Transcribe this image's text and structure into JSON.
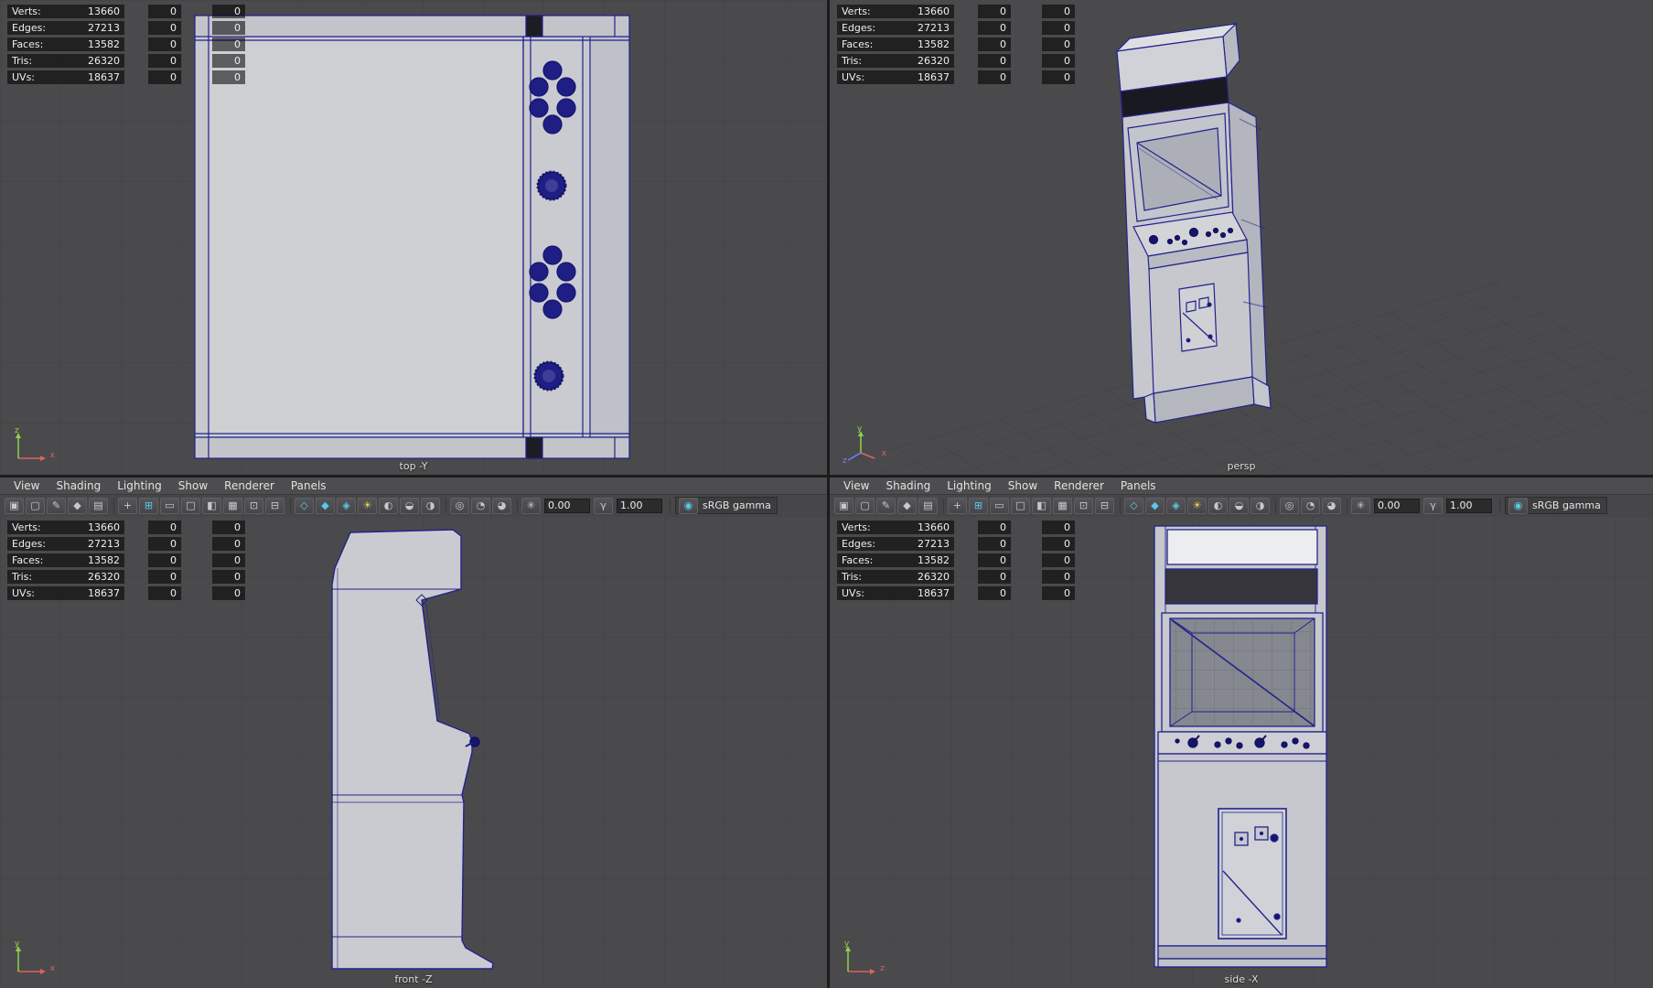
{
  "hud": {
    "rows": [
      {
        "label": "Verts:",
        "total": "13660",
        "c2": "0",
        "c3": "0"
      },
      {
        "label": "Edges:",
        "total": "27213",
        "c2": "0",
        "c3": "0"
      },
      {
        "label": "Faces:",
        "total": "13582",
        "c2": "0",
        "c3": "0"
      },
      {
        "label": "Tris:",
        "total": "26320",
        "c2": "0",
        "c3": "0"
      },
      {
        "label": "UVs:",
        "total": "18637",
        "c2": "0",
        "c3": "0"
      }
    ]
  },
  "menus": [
    "View",
    "Shading",
    "Lighting",
    "Show",
    "Renderer",
    "Panels"
  ],
  "toolbar": {
    "exposure_glyph": "✳",
    "exposure_value": "0.00",
    "gamma_glyph": "γ",
    "gamma_value": "1.00",
    "view_transform_glyph": "◉",
    "view_transform": "sRGB gamma",
    "icons": [
      {
        "name": "select-camera-icon",
        "glyph": "▣"
      },
      {
        "name": "lock-camera-icon",
        "glyph": "▢"
      },
      {
        "name": "camera-attributes-icon",
        "glyph": "✎"
      },
      {
        "name": "bookmark-icon",
        "glyph": "◆"
      },
      {
        "name": "image-plane-icon",
        "glyph": "▤",
        "sep": true
      },
      {
        "name": "pan-zoom-icon",
        "glyph": "+"
      },
      {
        "name": "grid-icon",
        "glyph": "⊞",
        "tint": "teal"
      },
      {
        "name": "film-gate-icon",
        "glyph": "▭"
      },
      {
        "name": "resolution-gate-icon",
        "glyph": "□"
      },
      {
        "name": "gate-mask-icon",
        "glyph": "◧"
      },
      {
        "name": "field-chart-icon",
        "glyph": "▦"
      },
      {
        "name": "safe-action-icon",
        "glyph": "⊡"
      },
      {
        "name": "safe-title-icon",
        "glyph": "⊟",
        "sep": true
      },
      {
        "name": "wireframe-icon",
        "glyph": "◇",
        "tint": "teal"
      },
      {
        "name": "shaded-icon",
        "glyph": "◆",
        "tint": "teal"
      },
      {
        "name": "textured-icon",
        "glyph": "◈",
        "tint": "teal"
      },
      {
        "name": "all-lights-icon",
        "glyph": "☀",
        "tint": "yellow"
      },
      {
        "name": "shadows-icon",
        "glyph": "◐"
      },
      {
        "name": "ambient-occlusion-icon",
        "glyph": "◒"
      },
      {
        "name": "motion-blur-icon",
        "glyph": "◑",
        "sep": true
      },
      {
        "name": "isolate-select-icon",
        "glyph": "◎"
      },
      {
        "name": "xray-icon",
        "glyph": "◔"
      },
      {
        "name": "joint-xray-icon",
        "glyph": "◕",
        "sep": true
      }
    ]
  },
  "viewports": {
    "top": {
      "label": "top -Y"
    },
    "persp": {
      "label": "persp"
    },
    "front": {
      "label": "front -Z"
    },
    "side": {
      "label": "side -X"
    }
  },
  "axes": {
    "x": "x",
    "y": "y",
    "z": "z"
  },
  "colors": {
    "viewport_background": "#4a4a4c",
    "grid_line": "#404043",
    "wireframe": "#22228c",
    "surface": "#c9cbd0",
    "marquee_dark": "#191921",
    "accent_teal": "#5bc8e8",
    "accent_yellow": "#e8d44d",
    "axis_x": "#e06060",
    "axis_y": "#8ed24a",
    "axis_z": "#6a86ff"
  }
}
